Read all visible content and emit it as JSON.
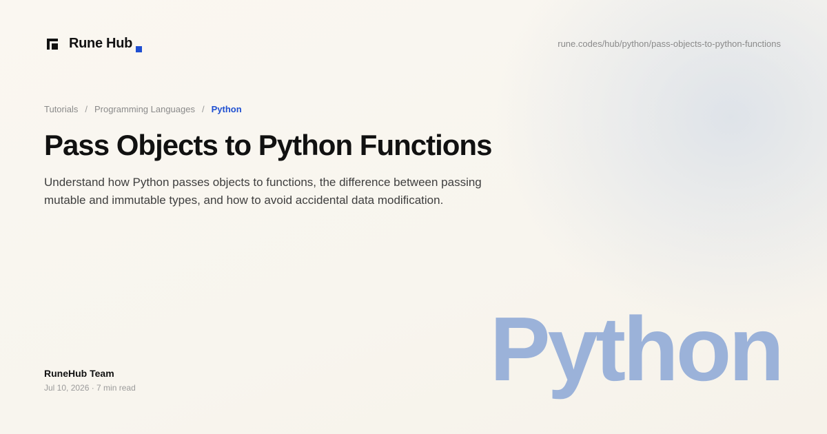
{
  "brand": {
    "name": "Rune Hub",
    "accent_color": "#1f4fd1",
    "logo_icon": "rune-hub-logo-icon"
  },
  "header": {
    "url": "rune.codes/hub/python/pass-objects-to-python-functions"
  },
  "breadcrumb": {
    "items": [
      "Tutorials",
      "Programming Languages",
      "Python"
    ],
    "separator": "/"
  },
  "article": {
    "title": "Pass Objects to Python Functions",
    "description": "Understand how Python passes objects to functions, the difference between passing mutable and immutable types, and how to avoid accidental data modification."
  },
  "footer": {
    "author": "RuneHub Team",
    "meta": "Jul 10, 2026 · 7 min read"
  },
  "hero": {
    "word": "Python",
    "color": "#9bb2d9"
  }
}
